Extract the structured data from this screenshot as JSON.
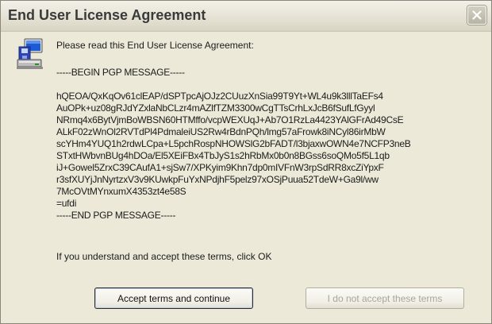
{
  "window": {
    "title": "End User License Agreement",
    "close_icon": "close-icon"
  },
  "dialog": {
    "icon": "setup-installer-icon",
    "intro": "Please read this End User License Agreement:",
    "pgp_begin": "-----BEGIN PGP MESSAGE-----",
    "pgp_lines": [
      "hQEOA/QxKqOv61clEAP/dSPTpcAjOJz2CUuzXnSia99T9Yt+WL4u9k3lllTaEFs4",
      "AuOPk+uz08gRJdYZxlaNbCLzr4mAZlfTZM3300wCgTTsCrhLxJcB6fSufLfGyyl",
      "NRmq4x6BytVjmBoWBSN60HTMffo/vcpWEXUqJ+Ab7O1RzLa4423YAlGFrAd49CsE",
      "ALkF02zWnOl2RVTdPl4PdmaleiUS2Rw4rBdnPQh/lmg57aFrowk8iNCyl86irMbW",
      "scYHm4YUQ1h2rdwLCpa+L5pchRospNHOWSlG2bFADT/l3bjaxwOWN4e7NCFP3neB",
      "STxtHWbvnBUg4hDOa/El5XEiFBx4TbJyS1s2hRbMx0b0n8BGss6soQMo5f5L1qb",
      "iJ+Gowel5ZrxC39CAufA1+sjSw7/XPKyim9Khn7dp0mIVFnW3rpSdRR8xcZiYpxF",
      "r3sfXUYjJnNyrtzxV3v9KUwkpFuYxNPdjhF5pelz97xOSjPuua52TdeW+Ga9l/ww",
      "7McOVtMYnxumX4353zt4e58S"
    ],
    "pgp_checksum": "=ufdi",
    "pgp_end": "-----END PGP MESSAGE-----",
    "notice": "If you understand and accept these terms, click OK"
  },
  "buttons": {
    "accept_label": "Accept terms and continue",
    "decline_label": "I do not accept these terms",
    "decline_disabled": true
  }
}
